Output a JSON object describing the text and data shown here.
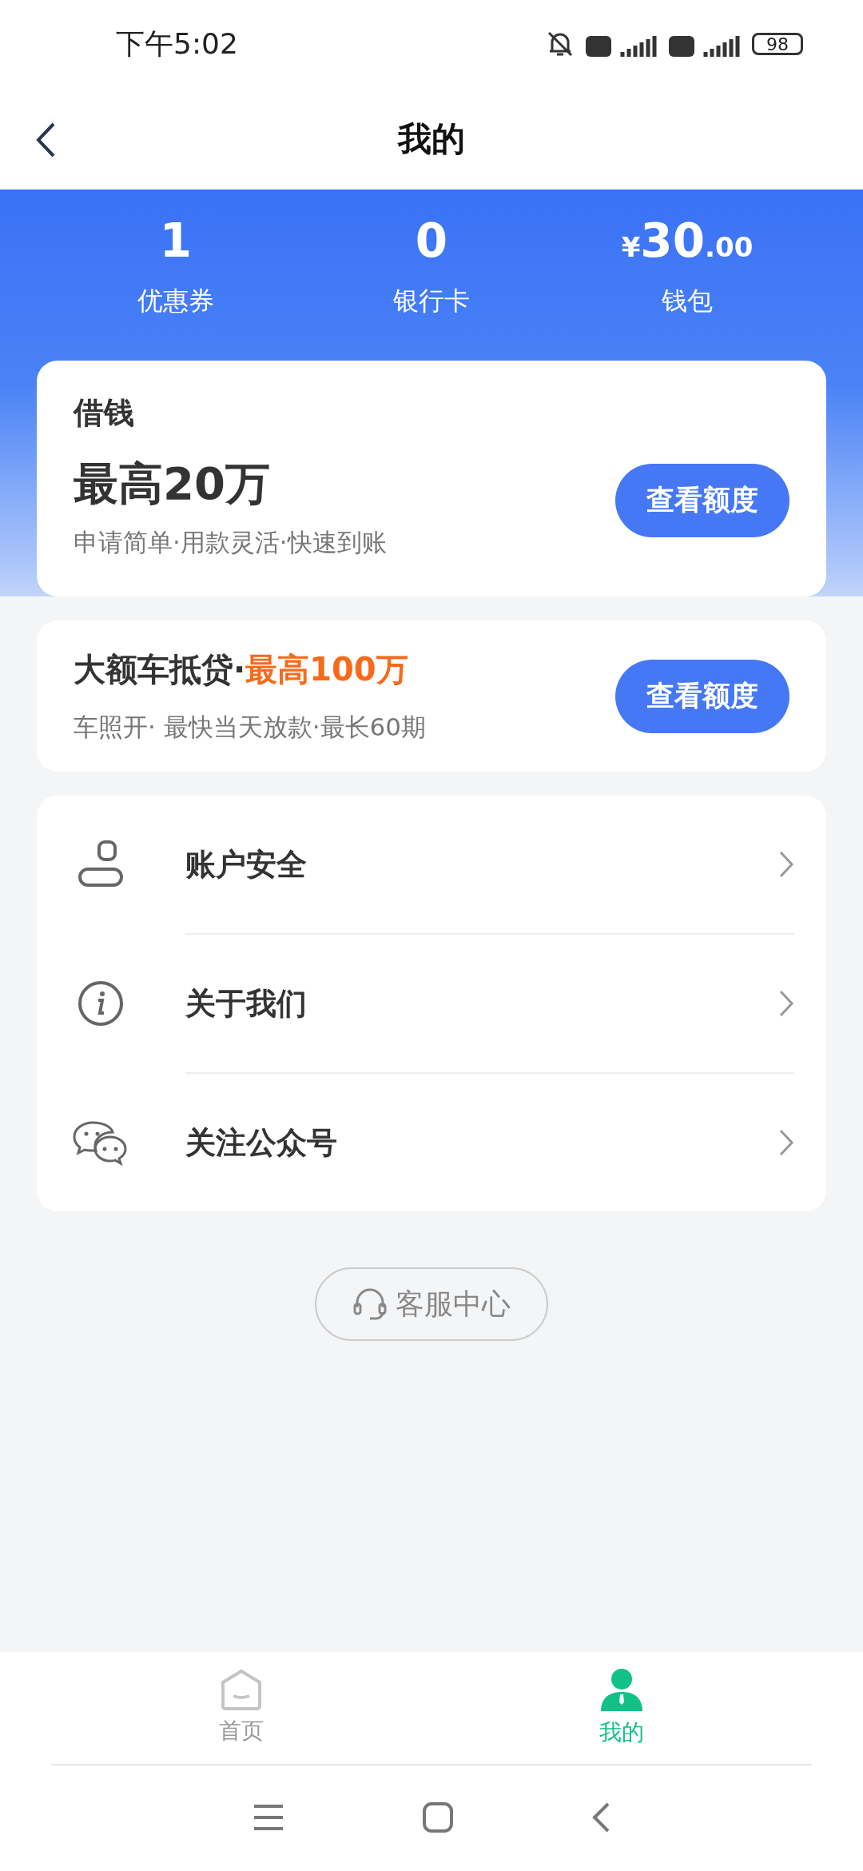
{
  "status_bar": {
    "time": "下午5:02",
    "battery": "98"
  },
  "header": {
    "title": "我的"
  },
  "stats": [
    {
      "value": "1",
      "label": "优惠券"
    },
    {
      "value": "0",
      "label": "银行卡"
    },
    {
      "prefix": "¥",
      "value": "30",
      "suffix": ".00",
      "label": "钱包"
    }
  ],
  "loan_card": {
    "title": "借钱",
    "amount": "最高20万",
    "subtitle": "申请简单·用款灵活·快速到账",
    "button": "查看额度"
  },
  "car_loan_card": {
    "title": "大额车抵贷·",
    "highlight": "最高100万",
    "subtitle": "车照开· 最快当天放款·最长60期",
    "button": "查看额度"
  },
  "menu": [
    {
      "kind": "account",
      "label": "账户安全"
    },
    {
      "kind": "info",
      "label": "关于我们"
    },
    {
      "kind": "wechat",
      "label": "关注公众号"
    }
  ],
  "service_button": "客服中心",
  "tab_bar": [
    {
      "kind": "home",
      "label": "首页",
      "selected": false
    },
    {
      "kind": "me",
      "label": "我的",
      "selected": true
    }
  ]
}
